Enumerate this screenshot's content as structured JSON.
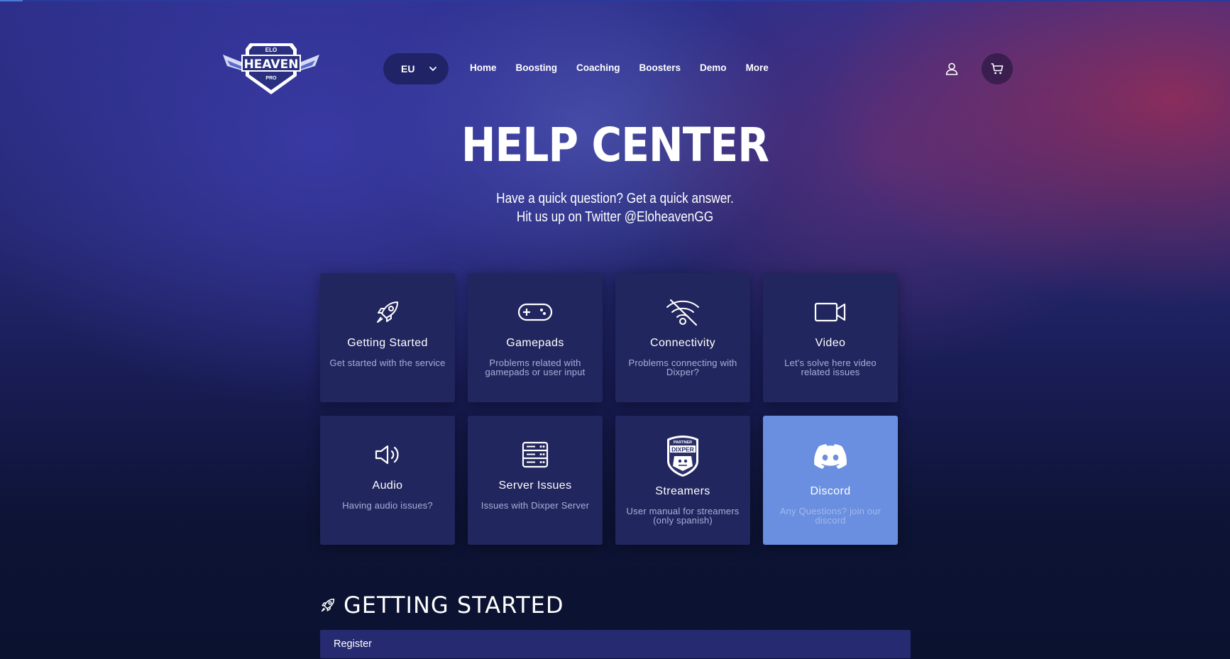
{
  "header": {
    "logo": {
      "top_text": "ELO",
      "main_text": "HEAVEN",
      "bottom_text": "PRO"
    },
    "region": {
      "label": "EU",
      "icon": "chevron-down-icon"
    },
    "nav": [
      {
        "label": "Home"
      },
      {
        "label": "Boosting"
      },
      {
        "label": "Coaching"
      },
      {
        "label": "Boosters"
      },
      {
        "label": "Demo"
      },
      {
        "label": "More"
      }
    ],
    "actions": {
      "user_icon": "user-icon",
      "cart_icon": "cart-icon"
    }
  },
  "hero": {
    "title": "HELP CENTER",
    "subtitle_line1": "Have a quick question? Get a quick answer.",
    "subtitle_line2": "Hit us up on Twitter @EloheavenGG"
  },
  "categories": [
    {
      "icon": "rocket-icon",
      "title": "Getting Started",
      "description": "Get started with the service"
    },
    {
      "icon": "gamepad-icon",
      "title": "Gamepads",
      "description": "Problems related with gamepads or user input"
    },
    {
      "icon": "wifi-off-icon",
      "title": "Connectivity",
      "description": "Problems connecting with Dixper?"
    },
    {
      "icon": "video-icon",
      "title": "Video",
      "description": "Let's solve here video related issues"
    },
    {
      "icon": "speaker-icon",
      "title": "Audio",
      "description": "Having audio issues?"
    },
    {
      "icon": "server-icon",
      "title": "Server Issues",
      "description": "Issues with Dixper Server"
    },
    {
      "icon": "dixper-partner-badge-icon",
      "title": "Streamers",
      "description": "User manual for streamers (only spanish)",
      "badge_top": "PARTNER",
      "badge_main": "DIXPER"
    },
    {
      "icon": "discord-icon",
      "title": "Discord",
      "description": "Any Questions? join our discord"
    }
  ],
  "section": {
    "icon": "rocket-icon",
    "title": "GETTING STARTED",
    "items": [
      {
        "label": "Register"
      }
    ]
  },
  "colors": {
    "card_bg": "#22265e",
    "discord_card_bg": "#6a8fe0",
    "card_desc": "#a8b0d8",
    "faq_row_bg": "#262a70",
    "page_dark": "#0d1334"
  }
}
